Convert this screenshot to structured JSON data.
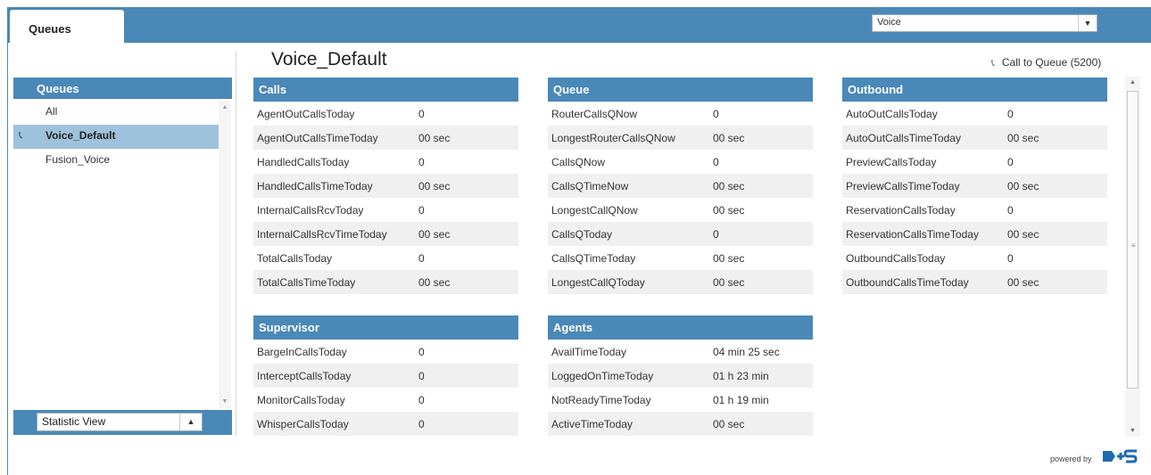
{
  "header": {
    "tab_label": "Queues",
    "mode_select_value": "Voice"
  },
  "sidebar": {
    "heading": "Queues",
    "items": [
      {
        "label": "All",
        "selected": false,
        "icon": ""
      },
      {
        "label": "Voice_Default",
        "selected": true,
        "icon": "phone-icon"
      },
      {
        "label": "Fusion_Voice",
        "selected": false,
        "icon": ""
      }
    ],
    "view_select_value": "Statistic View"
  },
  "main": {
    "title": "Voice_Default",
    "call_to_queue_label": "Call to Queue (5200)",
    "panels": {
      "calls": {
        "title": "Calls",
        "rows": [
          {
            "key": "AgentOutCallsToday",
            "value": "0"
          },
          {
            "key": "AgentOutCallsTimeToday",
            "value": "00 sec"
          },
          {
            "key": "HandledCallsToday",
            "value": "0"
          },
          {
            "key": "HandledCallsTimeToday",
            "value": "00 sec"
          },
          {
            "key": "InternalCallsRcvToday",
            "value": "0"
          },
          {
            "key": "InternalCallsRcvTimeToday",
            "value": "00 sec"
          },
          {
            "key": "TotalCallsToday",
            "value": "0"
          },
          {
            "key": "TotalCallsTimeToday",
            "value": "00 sec"
          }
        ]
      },
      "queue": {
        "title": "Queue",
        "rows": [
          {
            "key": "RouterCallsQNow",
            "value": "0"
          },
          {
            "key": "LongestRouterCallsQNow",
            "value": "00 sec"
          },
          {
            "key": "CallsQNow",
            "value": "0"
          },
          {
            "key": "CallsQTimeNow",
            "value": "00 sec"
          },
          {
            "key": "LongestCallQNow",
            "value": "00 sec"
          },
          {
            "key": "CallsQToday",
            "value": "0"
          },
          {
            "key": "CallsQTimeToday",
            "value": "00 sec"
          },
          {
            "key": "LongestCallQToday",
            "value": "00 sec"
          }
        ]
      },
      "outbound": {
        "title": "Outbound",
        "rows": [
          {
            "key": "AutoOutCallsToday",
            "value": "0"
          },
          {
            "key": "AutoOutCallsTimeToday",
            "value": "00 sec"
          },
          {
            "key": "PreviewCallsToday",
            "value": "0"
          },
          {
            "key": "PreviewCallsTimeToday",
            "value": "00 sec"
          },
          {
            "key": "ReservationCallsToday",
            "value": "0"
          },
          {
            "key": "ReservationCallsTimeToday",
            "value": "00 sec"
          },
          {
            "key": "OutboundCallsToday",
            "value": "0"
          },
          {
            "key": "OutboundCallsTimeToday",
            "value": "00 sec"
          }
        ]
      },
      "supervisor": {
        "title": "Supervisor",
        "rows": [
          {
            "key": "BargeInCallsToday",
            "value": "0"
          },
          {
            "key": "InterceptCallsToday",
            "value": "0"
          },
          {
            "key": "MonitorCallsToday",
            "value": "0"
          },
          {
            "key": "WhisperCallsToday",
            "value": "0"
          }
        ]
      },
      "agents": {
        "title": "Agents",
        "rows": [
          {
            "key": "AvailTimeToday",
            "value": "04 min 25 sec"
          },
          {
            "key": "LoggedOnTimeToday",
            "value": "01 h 23 min"
          },
          {
            "key": "NotReadyTimeToday",
            "value": "01 h 19 min"
          },
          {
            "key": "ActiveTimeToday",
            "value": "00 sec"
          }
        ]
      }
    }
  },
  "footer": {
    "powered_by": "powered by",
    "logo_text": "b+s"
  },
  "colors": {
    "accent": "#4a88b8",
    "selected_row": "#9ec2dc",
    "alt_row": "#f0f0f0"
  }
}
